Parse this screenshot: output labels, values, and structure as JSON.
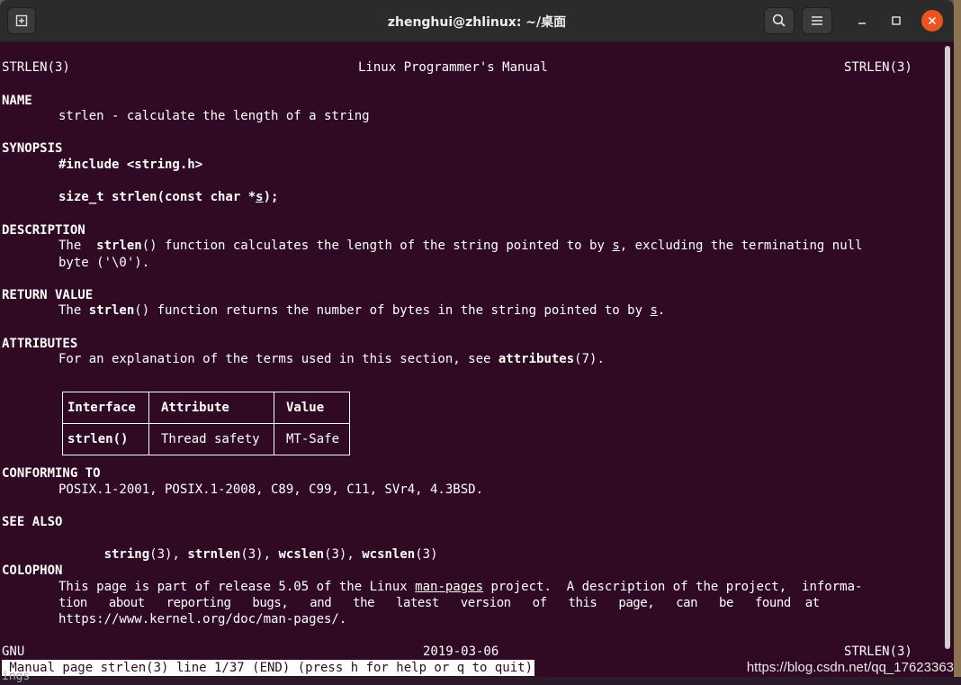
{
  "window": {
    "title": "zhenghui@zhlinux: ~/桌面"
  },
  "icons": {
    "new_tab": "new-tab-icon",
    "search": "search-icon",
    "menu": "hamburger-menu-icon",
    "minimize": "minimize-icon",
    "maximize": "maximize-icon",
    "close": "close-icon"
  },
  "man": {
    "header_left": "STRLEN(3)",
    "header_center": "Linux Programmer's Manual",
    "header_right": "STRLEN(3)",
    "name_heading": "NAME",
    "name_text": "strlen - calculate the length of a string",
    "synopsis_heading": "SYNOPSIS",
    "synopsis_include": "#include <string.h>",
    "synopsis_proto_a": "size_t strlen(const char *",
    "synopsis_proto_s": "s",
    "synopsis_proto_b": ");",
    "description_heading": "DESCRIPTION",
    "desc_l1_a": "The  ",
    "desc_l1_fn": "strlen",
    "desc_l1_b": "() function calculates the length of the string pointed to by ",
    "desc_l1_s": "s",
    "desc_l1_c": ", excluding the terminating null",
    "desc_l2": "byte ('\\0').",
    "return_heading": "RETURN VALUE",
    "ret_a": "The ",
    "ret_fn": "strlen",
    "ret_b": "() function returns the number of bytes in the string pointed to by ",
    "ret_s": "s",
    "ret_c": ".",
    "attributes_heading": "ATTRIBUTES",
    "attr_text_a": "For an explanation of the terms used in this section, see ",
    "attr_text_ref": "attributes",
    "attr_text_b": "(7).",
    "table_headers": [
      "Interface",
      "Attribute",
      "Value"
    ],
    "table_row": [
      "strlen()",
      "Thread safety",
      "MT-Safe"
    ],
    "conforming_heading": "CONFORMING TO",
    "conforming_text": "POSIX.1-2001, POSIX.1-2008, C89, C99, C11, SVr4, 4.3BSD.",
    "see_also_heading": "SEE ALSO",
    "see_also": [
      {
        "name": "string",
        "sec": "(3)",
        "sep": ", "
      },
      {
        "name": "strnlen",
        "sec": "(3)",
        "sep": ", "
      },
      {
        "name": "wcslen",
        "sec": "(3)",
        "sep": ", "
      },
      {
        "name": "wcsnlen",
        "sec": "(3)",
        "sep": ""
      }
    ],
    "colophon_heading": "COLOPHON",
    "colophon_l1_a": "This page is part of release 5.05 of the Linux ",
    "colophon_l1_link": "man-pages",
    "colophon_l1_b": " project.  A description of the project,  informa‐",
    "colophon_l2": "tion   about   reporting   bugs,   and   the   latest   version   of   this   page,   can   be   found  at",
    "colophon_l3": "https://www.kernel.org/doc/man-pages/.",
    "footer_left": "GNU",
    "footer_center": "2019-03-06",
    "footer_right": "STRLEN(3)"
  },
  "status_line": " Manual page strlen(3) line 1/37 (END) (press h for help or q to quit)",
  "below_text": "ings",
  "watermark": "https://blog.csdn.net/qq_17623363"
}
